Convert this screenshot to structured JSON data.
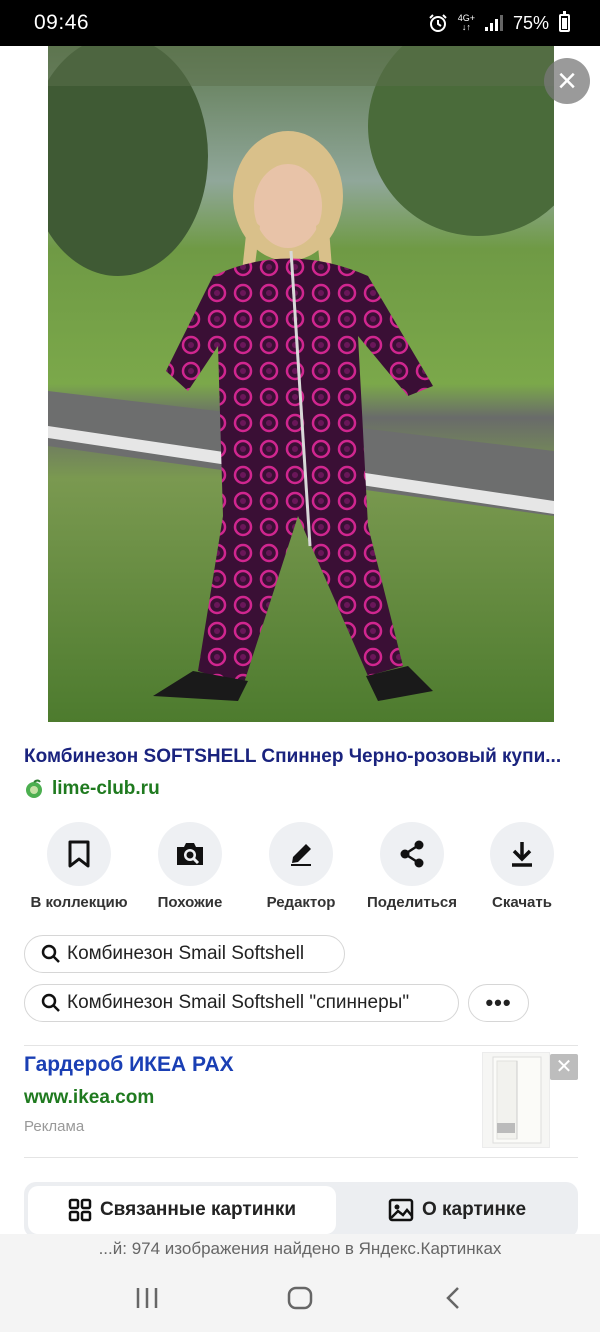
{
  "status_bar": {
    "time": "09:46",
    "network": "4G+",
    "battery": "75%",
    "icons": [
      "alarm-icon",
      "network-icon",
      "signal-icon",
      "battery-icon"
    ]
  },
  "image_viewer": {
    "close_icon": "close-icon",
    "photo_description": "girl in pink-black patterned softshell jumpsuit on grass"
  },
  "result": {
    "title": "Комбинезон SOFTSHELL Спиннер Черно-розовый купи...",
    "domain": "lime-club.ru"
  },
  "actions": [
    {
      "label": "В коллекцию",
      "icon": "bookmark-icon"
    },
    {
      "label": "Похожие",
      "icon": "camera-search-icon"
    },
    {
      "label": "Редактор",
      "icon": "pencil-icon"
    },
    {
      "label": "Поделиться",
      "icon": "share-icon"
    },
    {
      "label": "Скачать",
      "icon": "download-icon"
    }
  ],
  "suggestions": [
    "Комбинезон Smail Softshell",
    "Комбинезон Smail Softshell \"спиннеры\""
  ],
  "more_label": "•••",
  "ad": {
    "title": "Гардероб ИКЕА PAX",
    "url": "www.ikea.com",
    "label": "Реклама",
    "close": "✕"
  },
  "tabs": {
    "related": "Связанные картинки",
    "about": "О картинке"
  },
  "footer": {
    "text": "...й: 974 изображения найдено в Яндекс.Картинках"
  },
  "colors": {
    "title": "#1a237e",
    "domain": "#1f7a1f",
    "ad_title": "#1a3fb4"
  }
}
